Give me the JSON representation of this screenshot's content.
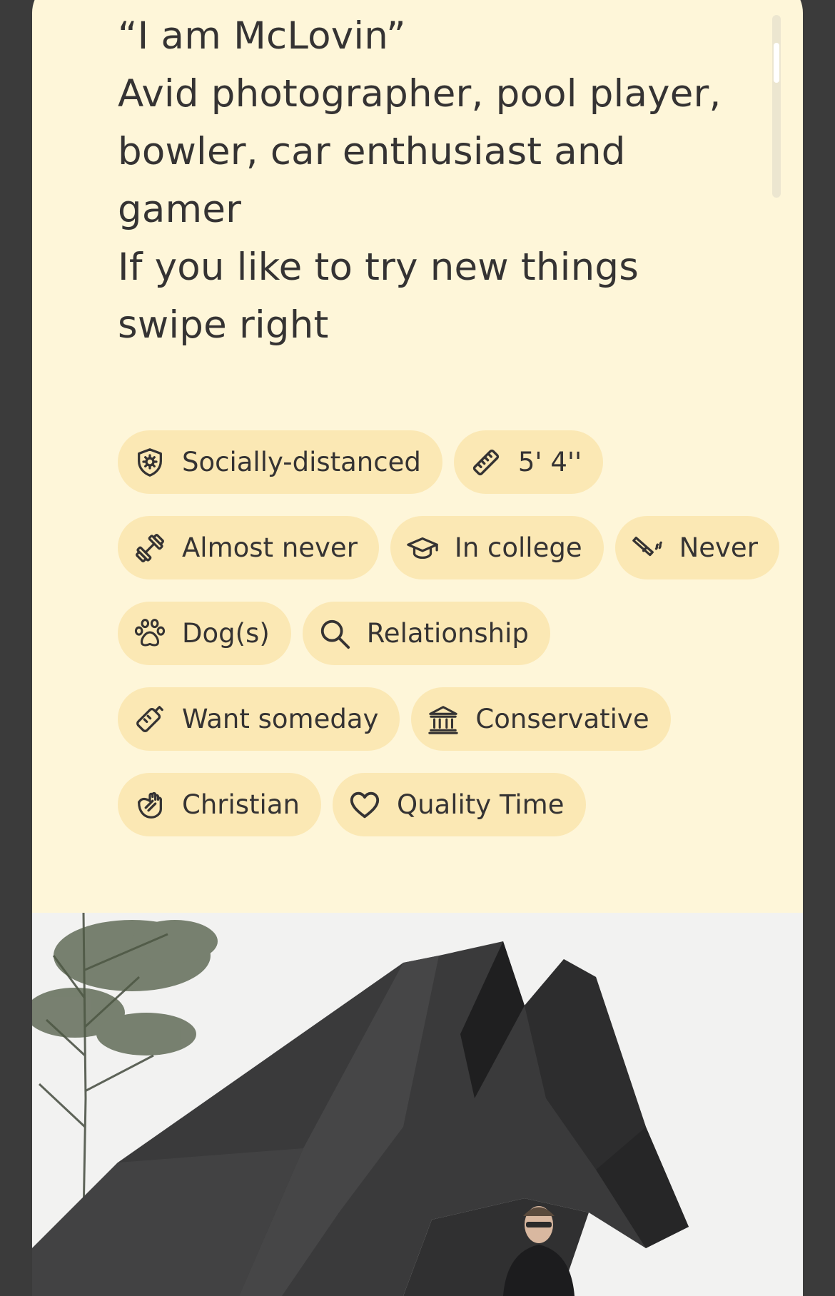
{
  "bio": {
    "lines": [
      "“I am McLovin”",
      "Avid photographer, pool player,",
      "bowler, car enthusiast and",
      "gamer",
      "If you like to try new things",
      "swipe right"
    ]
  },
  "chips": [
    {
      "icon": "shield-virus-icon",
      "label": "Socially-distanced"
    },
    {
      "icon": "ruler-icon",
      "label": "5' 4''"
    },
    {
      "icon": "dumbbell-icon",
      "label": "Almost never"
    },
    {
      "icon": "graduation-cap-icon",
      "label": "In college"
    },
    {
      "icon": "cigarette-icon",
      "label": "Never"
    },
    {
      "icon": "paw-icon",
      "label": "Dog(s)"
    },
    {
      "icon": "search-icon",
      "label": "Relationship"
    },
    {
      "icon": "pacifier-icon",
      "label": "Want someday"
    },
    {
      "icon": "government-building-icon",
      "label": "Conservative"
    },
    {
      "icon": "praying-hands-icon",
      "label": "Christian"
    },
    {
      "icon": "heart-icon",
      "label": "Quality Time"
    }
  ],
  "colors": {
    "card_background": "#fef6d9",
    "chip_background": "#fbe8b4",
    "text": "#353333",
    "page_background": "#3b3b3b"
  }
}
